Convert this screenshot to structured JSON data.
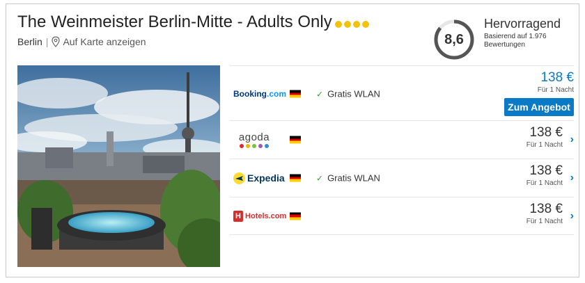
{
  "hotel": {
    "name": "The Weinmeister Berlin-Mitte - Adults Only",
    "star_count": 4,
    "city": "Berlin",
    "map_link": "Auf Karte anzeigen"
  },
  "rating": {
    "score": "8,6",
    "score_fraction": 0.86,
    "label": "Hervorragend",
    "basis": "Basierend auf 1.976 Bewertungen"
  },
  "colors": {
    "accent_blue": "#0a7ac6",
    "star_yellow": "#f4c20d"
  },
  "offers": [
    {
      "provider": "Booking.com",
      "logo_main": "Booking",
      "logo_suffix": ".com",
      "flag": "de-flag-icon",
      "amenity": "Gratis WLAN",
      "price": "138 €",
      "per_night": "Für 1 Nacht",
      "cta": "Zum Angebot",
      "highlighted": true
    },
    {
      "provider": "agoda",
      "logo_main": "agoda",
      "flag": "de-flag-icon",
      "amenity": "",
      "price": "138 €",
      "per_night": "Für 1 Nacht",
      "arrow": "›"
    },
    {
      "provider": "Expedia",
      "logo_main": "Expedia",
      "flag": "de-flag-icon",
      "amenity": "Gratis WLAN",
      "price": "138 €",
      "per_night": "Für 1 Nacht",
      "arrow": "›"
    },
    {
      "provider": "Hotels.com",
      "logo_main": "Hotels.com",
      "flag": "de-flag-icon",
      "amenity": "",
      "price": "138 €",
      "per_night": "Für 1 Nacht",
      "arrow": "›"
    }
  ]
}
